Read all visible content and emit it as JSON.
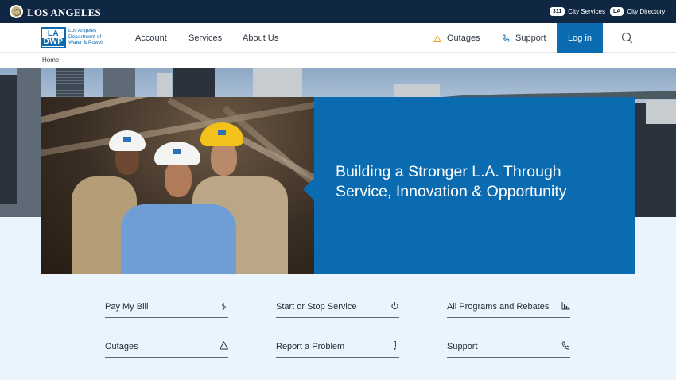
{
  "city_bar": {
    "name": "LOS ANGELES",
    "links": [
      {
        "badge": "311",
        "label": "City Services"
      },
      {
        "badge": "LA",
        "label": "City Directory"
      }
    ]
  },
  "logo": {
    "mark_top": "LA",
    "mark_bottom": "DWP",
    "lines": [
      "Los Angeles",
      "Department of",
      "Water & Power"
    ]
  },
  "nav": {
    "items": [
      "Account",
      "Services",
      "About Us"
    ],
    "outages": "Outages",
    "support": "Support",
    "login": "Log in"
  },
  "breadcrumb": "Home",
  "hero": {
    "title": "Building a Stronger L.A. Through Service, Innovation & Opportunity"
  },
  "quick_links": [
    {
      "label": "Pay My Bill",
      "icon": "dollar-icon"
    },
    {
      "label": "Start or Stop Service",
      "icon": "power-icon"
    },
    {
      "label": "All Programs and Rebates",
      "icon": "bar-chart-icon"
    },
    {
      "label": "Outages",
      "icon": "warning-icon"
    },
    {
      "label": "Report a Problem",
      "icon": "exclamation-icon"
    },
    {
      "label": "Support",
      "icon": "phone-icon"
    }
  ],
  "colors": {
    "brand_blue": "#0a6bb0",
    "city_navy": "#102744",
    "page_bg": "#eaf4fc",
    "warning": "#e8a21a"
  }
}
